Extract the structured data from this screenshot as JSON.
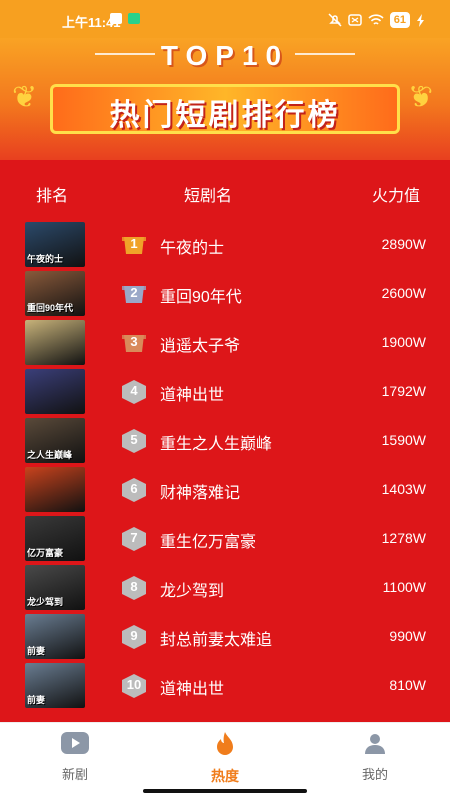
{
  "status": {
    "time": "上午11:41",
    "battery": "61"
  },
  "header": {
    "top10": "TOP10",
    "title": "热门短剧排行榜"
  },
  "columns": {
    "rank": "排名",
    "name": "短剧名",
    "heat": "火力值"
  },
  "rows": [
    {
      "rank": "1",
      "name": "午夜的士",
      "heat": "2890W",
      "caption": "午夜的士",
      "thumb_color": "#2c4a6b"
    },
    {
      "rank": "2",
      "name": "重回90年代",
      "heat": "2600W",
      "caption": "重回90年代",
      "thumb_color": "#8a5a3b"
    },
    {
      "rank": "3",
      "name": "逍遥太子爷",
      "heat": "1900W",
      "caption": "",
      "thumb_color": "#c8b37a"
    },
    {
      "rank": "4",
      "name": "道神出世",
      "heat": "1792W",
      "caption": "",
      "thumb_color": "#3b3f7a"
    },
    {
      "rank": "5",
      "name": "重生之人生巅峰",
      "heat": "1590W",
      "caption": "之人生巅峰",
      "thumb_color": "#5a4a3a"
    },
    {
      "rank": "6",
      "name": "财神落难记",
      "heat": "1403W",
      "caption": "",
      "thumb_color": "#c9431d"
    },
    {
      "rank": "7",
      "name": "重生亿万富豪",
      "heat": "1278W",
      "caption": "亿万富豪",
      "thumb_color": "#3a3a3a"
    },
    {
      "rank": "8",
      "name": "龙少驾到",
      "heat": "1100W",
      "caption": "龙少驾到",
      "thumb_color": "#4a4a4a"
    },
    {
      "rank": "9",
      "name": "封总前妻太难追",
      "heat": "990W",
      "caption": "前妻",
      "thumb_color": "#6a7d92"
    },
    {
      "rank": "10",
      "name": "道神出世",
      "heat": "810W",
      "caption": "前妻",
      "thumb_color": "#6a7d92"
    }
  ],
  "tabs": [
    {
      "label": "新剧",
      "icon": "play-icon"
    },
    {
      "label": "热度",
      "icon": "flame-icon"
    },
    {
      "label": "我的",
      "icon": "user-icon"
    }
  ],
  "colors": {
    "accent": "#f07d1c",
    "list_bg": "#dd1619",
    "gold": "#f0a229",
    "silver": "#9aa8c8",
    "bronze": "#d98a5a",
    "plain": "#bcbcbc"
  }
}
